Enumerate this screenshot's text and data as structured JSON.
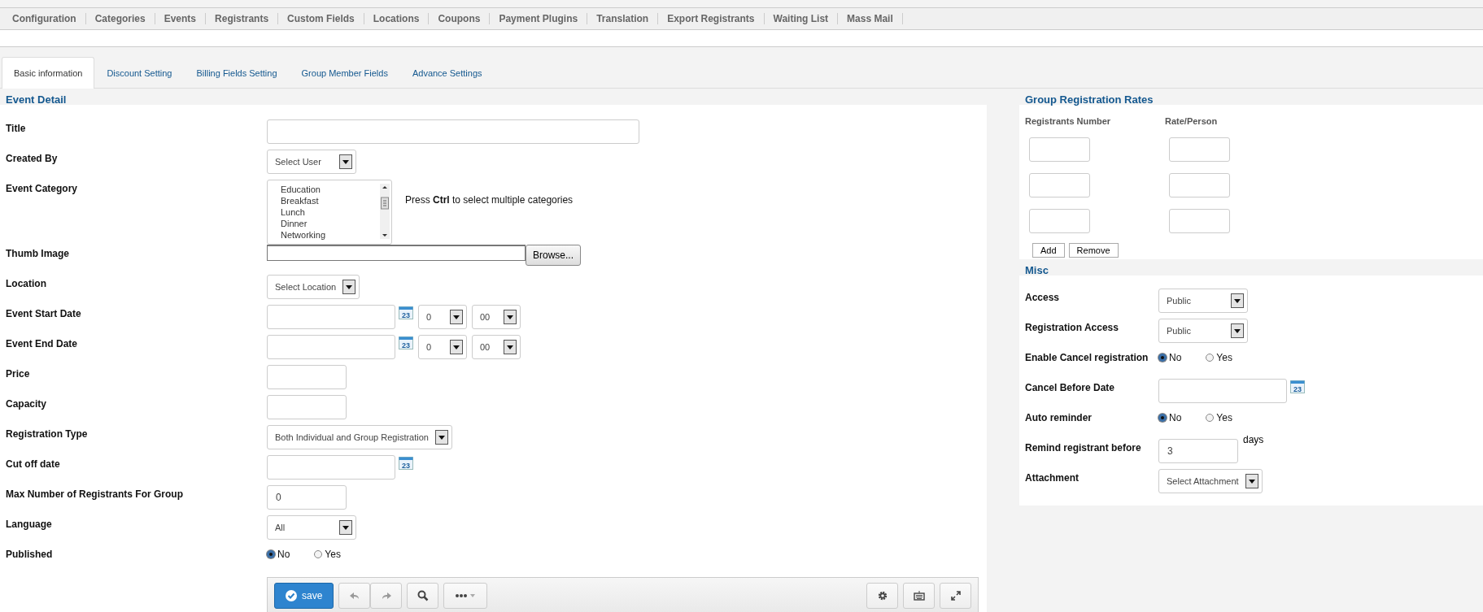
{
  "top_menu": [
    "Configuration",
    "Categories",
    "Events",
    "Registrants",
    "Custom Fields",
    "Locations",
    "Coupons",
    "Payment Plugins",
    "Translation",
    "Export Registrants",
    "Waiting List",
    "Mass Mail"
  ],
  "tabs": [
    {
      "label": "Basic information",
      "selected": true
    },
    {
      "label": "Discount Setting",
      "selected": false
    },
    {
      "label": "Billing Fields Setting",
      "selected": false
    },
    {
      "label": "Group Member Fields",
      "selected": false
    },
    {
      "label": "Advance Settings",
      "selected": false
    }
  ],
  "event_detail": {
    "heading": "Event Detail",
    "fields": [
      {
        "kind": "text",
        "label": "Title"
      },
      {
        "kind": "select",
        "label": "Created By",
        "value": "Select User"
      },
      {
        "kind": "listbox",
        "label": "Event Category",
        "options": [
          "Education",
          "Breakfast",
          "Lunch",
          "Dinner",
          "Networking"
        ],
        "hint": "Press **Ctrl** to select multiple categories"
      },
      {
        "kind": "file",
        "label": "Thumb Image",
        "button": "Browse..."
      },
      {
        "kind": "select",
        "label": "Location",
        "value": "Select Location"
      },
      {
        "kind": "datetime",
        "label": "Event Start Date",
        "calendar": "23",
        "hour": "0",
        "minute": "00"
      },
      {
        "kind": "datetime",
        "label": "Event End Date",
        "calendar": "23",
        "hour": "0",
        "minute": "00"
      },
      {
        "kind": "number",
        "label": "Price"
      },
      {
        "kind": "number",
        "label": "Capacity"
      },
      {
        "kind": "select",
        "label": "Registration Type",
        "value": "Both Individual and Group Registration"
      },
      {
        "kind": "date",
        "label": "Cut off date",
        "calendar": "23"
      },
      {
        "kind": "number",
        "label": "Max Number of Registrants For Group",
        "value": "0"
      },
      {
        "kind": "select",
        "label": "Language",
        "value": "All"
      },
      {
        "kind": "radio",
        "label": "Published",
        "options": [
          {
            "label": "No",
            "selected": true
          },
          {
            "label": "Yes",
            "selected": false
          }
        ]
      }
    ]
  },
  "editor_toolbar": {
    "save": "save"
  },
  "group_rates": {
    "heading": "Group Registration Rates",
    "columns": [
      "Registrants Number",
      "Rate/Person"
    ],
    "rows": [
      {
        "kind": "input-pair"
      },
      {
        "kind": "input-pair"
      },
      {
        "kind": "input-pair"
      }
    ],
    "buttons": [
      "Add",
      "Remove"
    ]
  },
  "misc": {
    "heading": "Misc",
    "fields": [
      {
        "kind": "select",
        "label": "Access",
        "value": "Public"
      },
      {
        "kind": "select",
        "label": "Registration Access",
        "value": "Public"
      },
      {
        "kind": "radio",
        "label": "Enable Cancel registration",
        "options": [
          {
            "label": "No",
            "selected": true
          },
          {
            "label": "Yes",
            "selected": false
          }
        ]
      },
      {
        "kind": "date",
        "label": "Cancel Before Date",
        "calendar": "23"
      },
      {
        "kind": "radio",
        "label": "Auto reminder",
        "options": [
          {
            "label": "No",
            "selected": true
          },
          {
            "label": "Yes",
            "selected": false
          }
        ]
      },
      {
        "kind": "number",
        "label": "Remind registrant before",
        "value": "3",
        "suffix": "days"
      },
      {
        "kind": "select",
        "label": "Attachment",
        "value": "Select Attachment"
      }
    ]
  }
}
